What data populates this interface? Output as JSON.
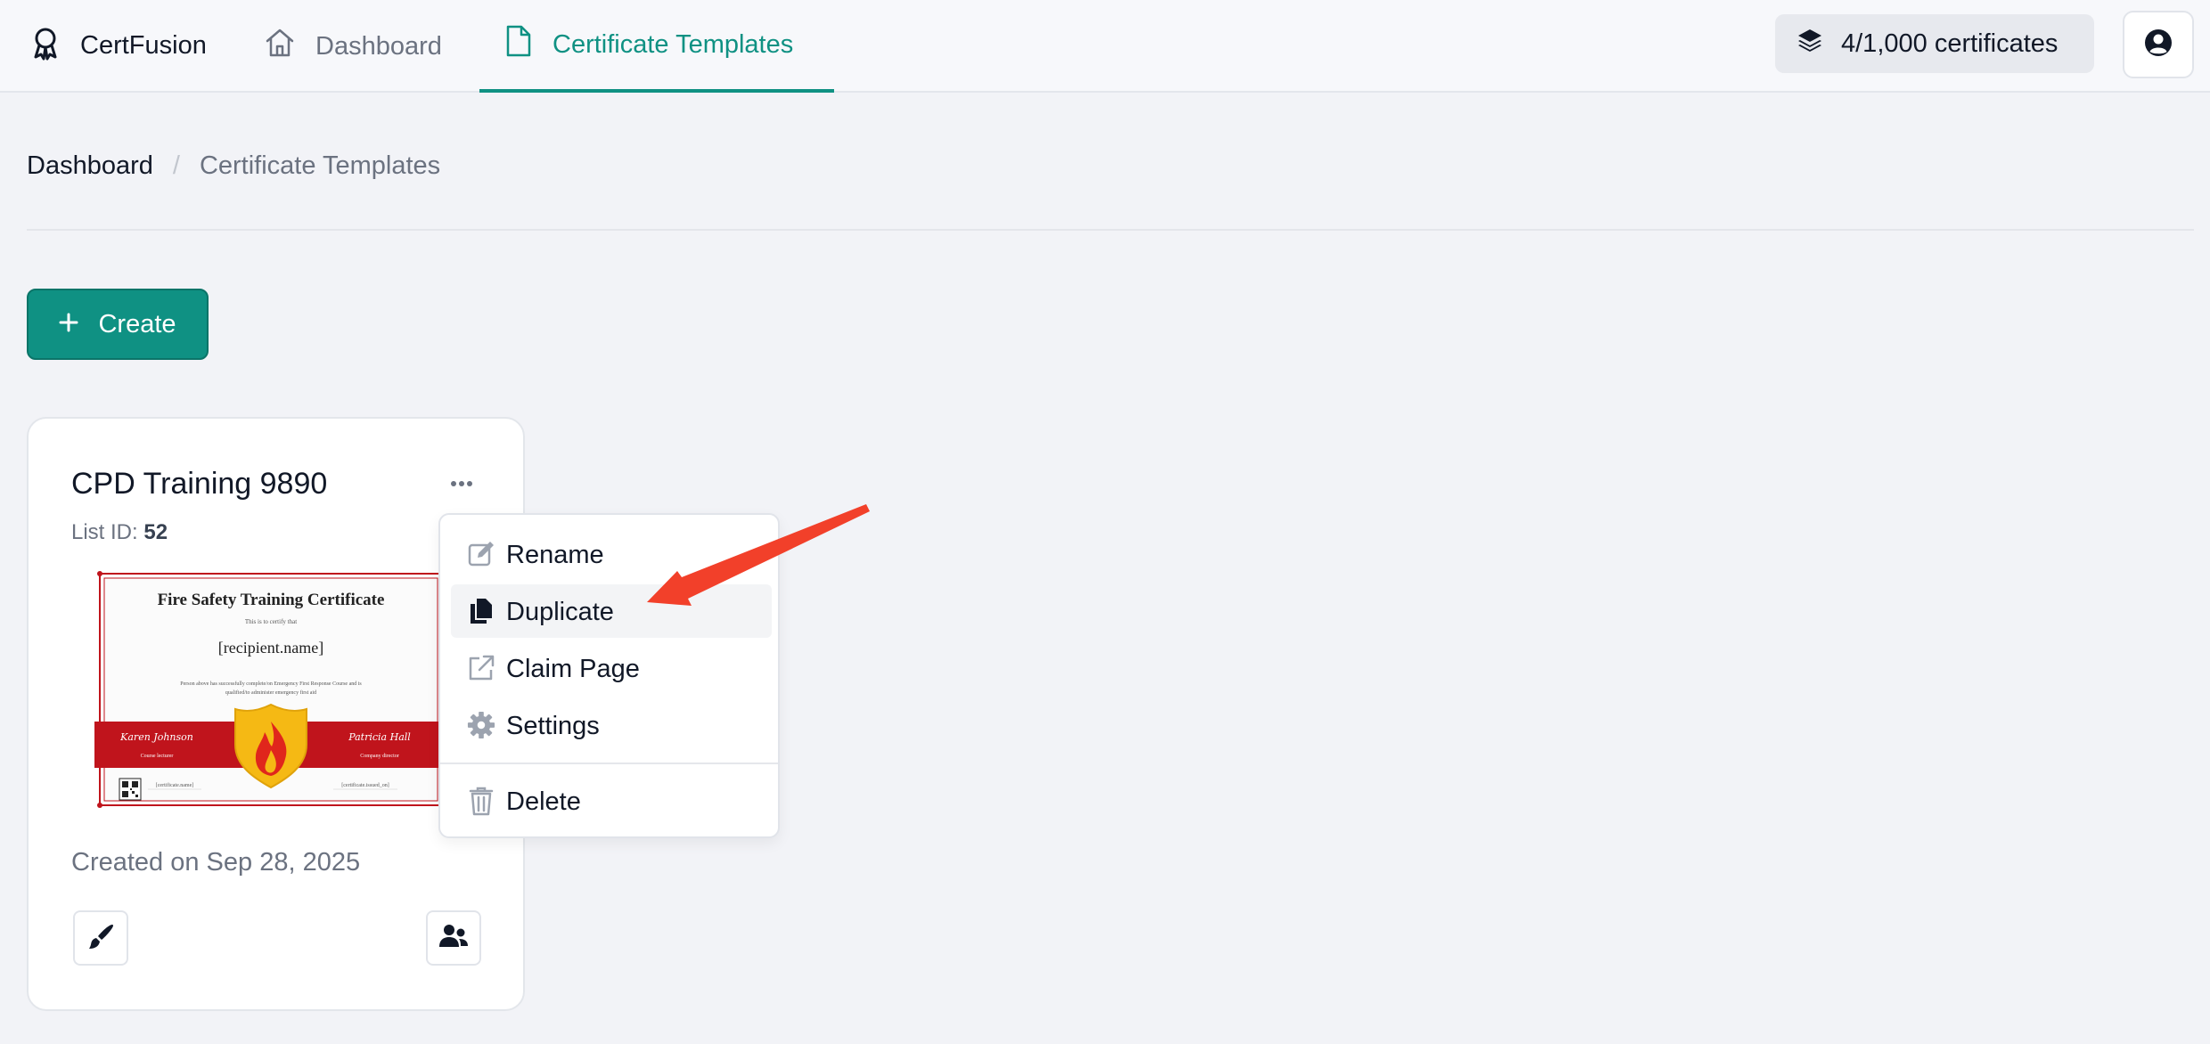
{
  "nav": {
    "brand": "CertFusion",
    "items": [
      {
        "label": "Dashboard",
        "active": false
      },
      {
        "label": "Certificate Templates",
        "active": true
      }
    ],
    "credits": "4/1,000 certificates"
  },
  "breadcrumb": {
    "items": [
      "Dashboard",
      "Certificate Templates"
    ],
    "separator": "/"
  },
  "create_label": "Create",
  "card": {
    "title": "CPD Training 9890",
    "list_id_label": "List ID:",
    "list_id": "52",
    "created": "Created on Sep 28, 2025",
    "thumbnail": {
      "title": "Fire Safety Training Certificate",
      "subtitle": "This is to certify that",
      "recipient": "[recipient.name]",
      "body_line1": "Person above has successfully complete/on Emergency First Response Course and is",
      "body_line2": "qualified/to administer emergency first aid",
      "signer1_name": "Karen Johnson",
      "signer1_role": "Course lecturer",
      "signer2_name": "Patricia Hall",
      "signer2_role": "Company director",
      "field1": "[certificate.name]",
      "field2": "[certificate.issued_on]"
    }
  },
  "menu": {
    "items": [
      {
        "label": "Rename",
        "icon": "edit-icon",
        "highlighted": false
      },
      {
        "label": "Duplicate",
        "icon": "copy-icon",
        "highlighted": true
      },
      {
        "label": "Claim Page",
        "icon": "external-link-icon",
        "highlighted": false
      },
      {
        "label": "Settings",
        "icon": "gear-icon",
        "highlighted": false
      },
      {
        "label": "Delete",
        "icon": "trash-icon",
        "highlighted": false
      }
    ]
  },
  "colors": {
    "accent": "#0f9183",
    "arrow": "#f2402a",
    "certificate_band": "#c0141c",
    "badge": "#f5b914"
  }
}
